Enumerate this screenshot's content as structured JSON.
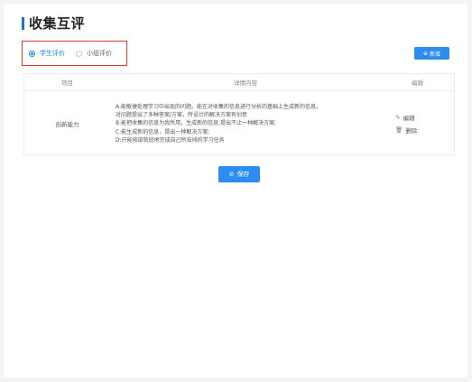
{
  "page": {
    "title": "收集互评"
  },
  "tabs": [
    {
      "label": "学生评价",
      "selected": true
    },
    {
      "label": "小组评价",
      "selected": false
    }
  ],
  "toolbar": {
    "add_label": "新增",
    "add_icon": "plus-circle-icon"
  },
  "table": {
    "headers": [
      "项目",
      "详情内容",
      "编辑"
    ],
    "rows": [
      {
        "item": "创新能力",
        "details": [
          "A:能敏捷处理学习中出现的问题。能在对收集的信息进行分析的基础上生成新的信息。",
          "对问题提出了多种答案/方案，所设计的解决方案有创意",
          "B:能把收集的信息为我所用，生成新的信息;提出不止一种解决方案;",
          "C:能生成新的信息，提出一种解决方案;",
          "D:只能按部就班地完成自己所安排的学习任务"
        ],
        "edit_label": "编辑",
        "delete_label": "删除"
      }
    ]
  },
  "footer": {
    "save_label": "保存",
    "save_icon": "check-circle-icon"
  },
  "colors": {
    "accent": "#2d8cf0",
    "highlight": "#e53935"
  }
}
